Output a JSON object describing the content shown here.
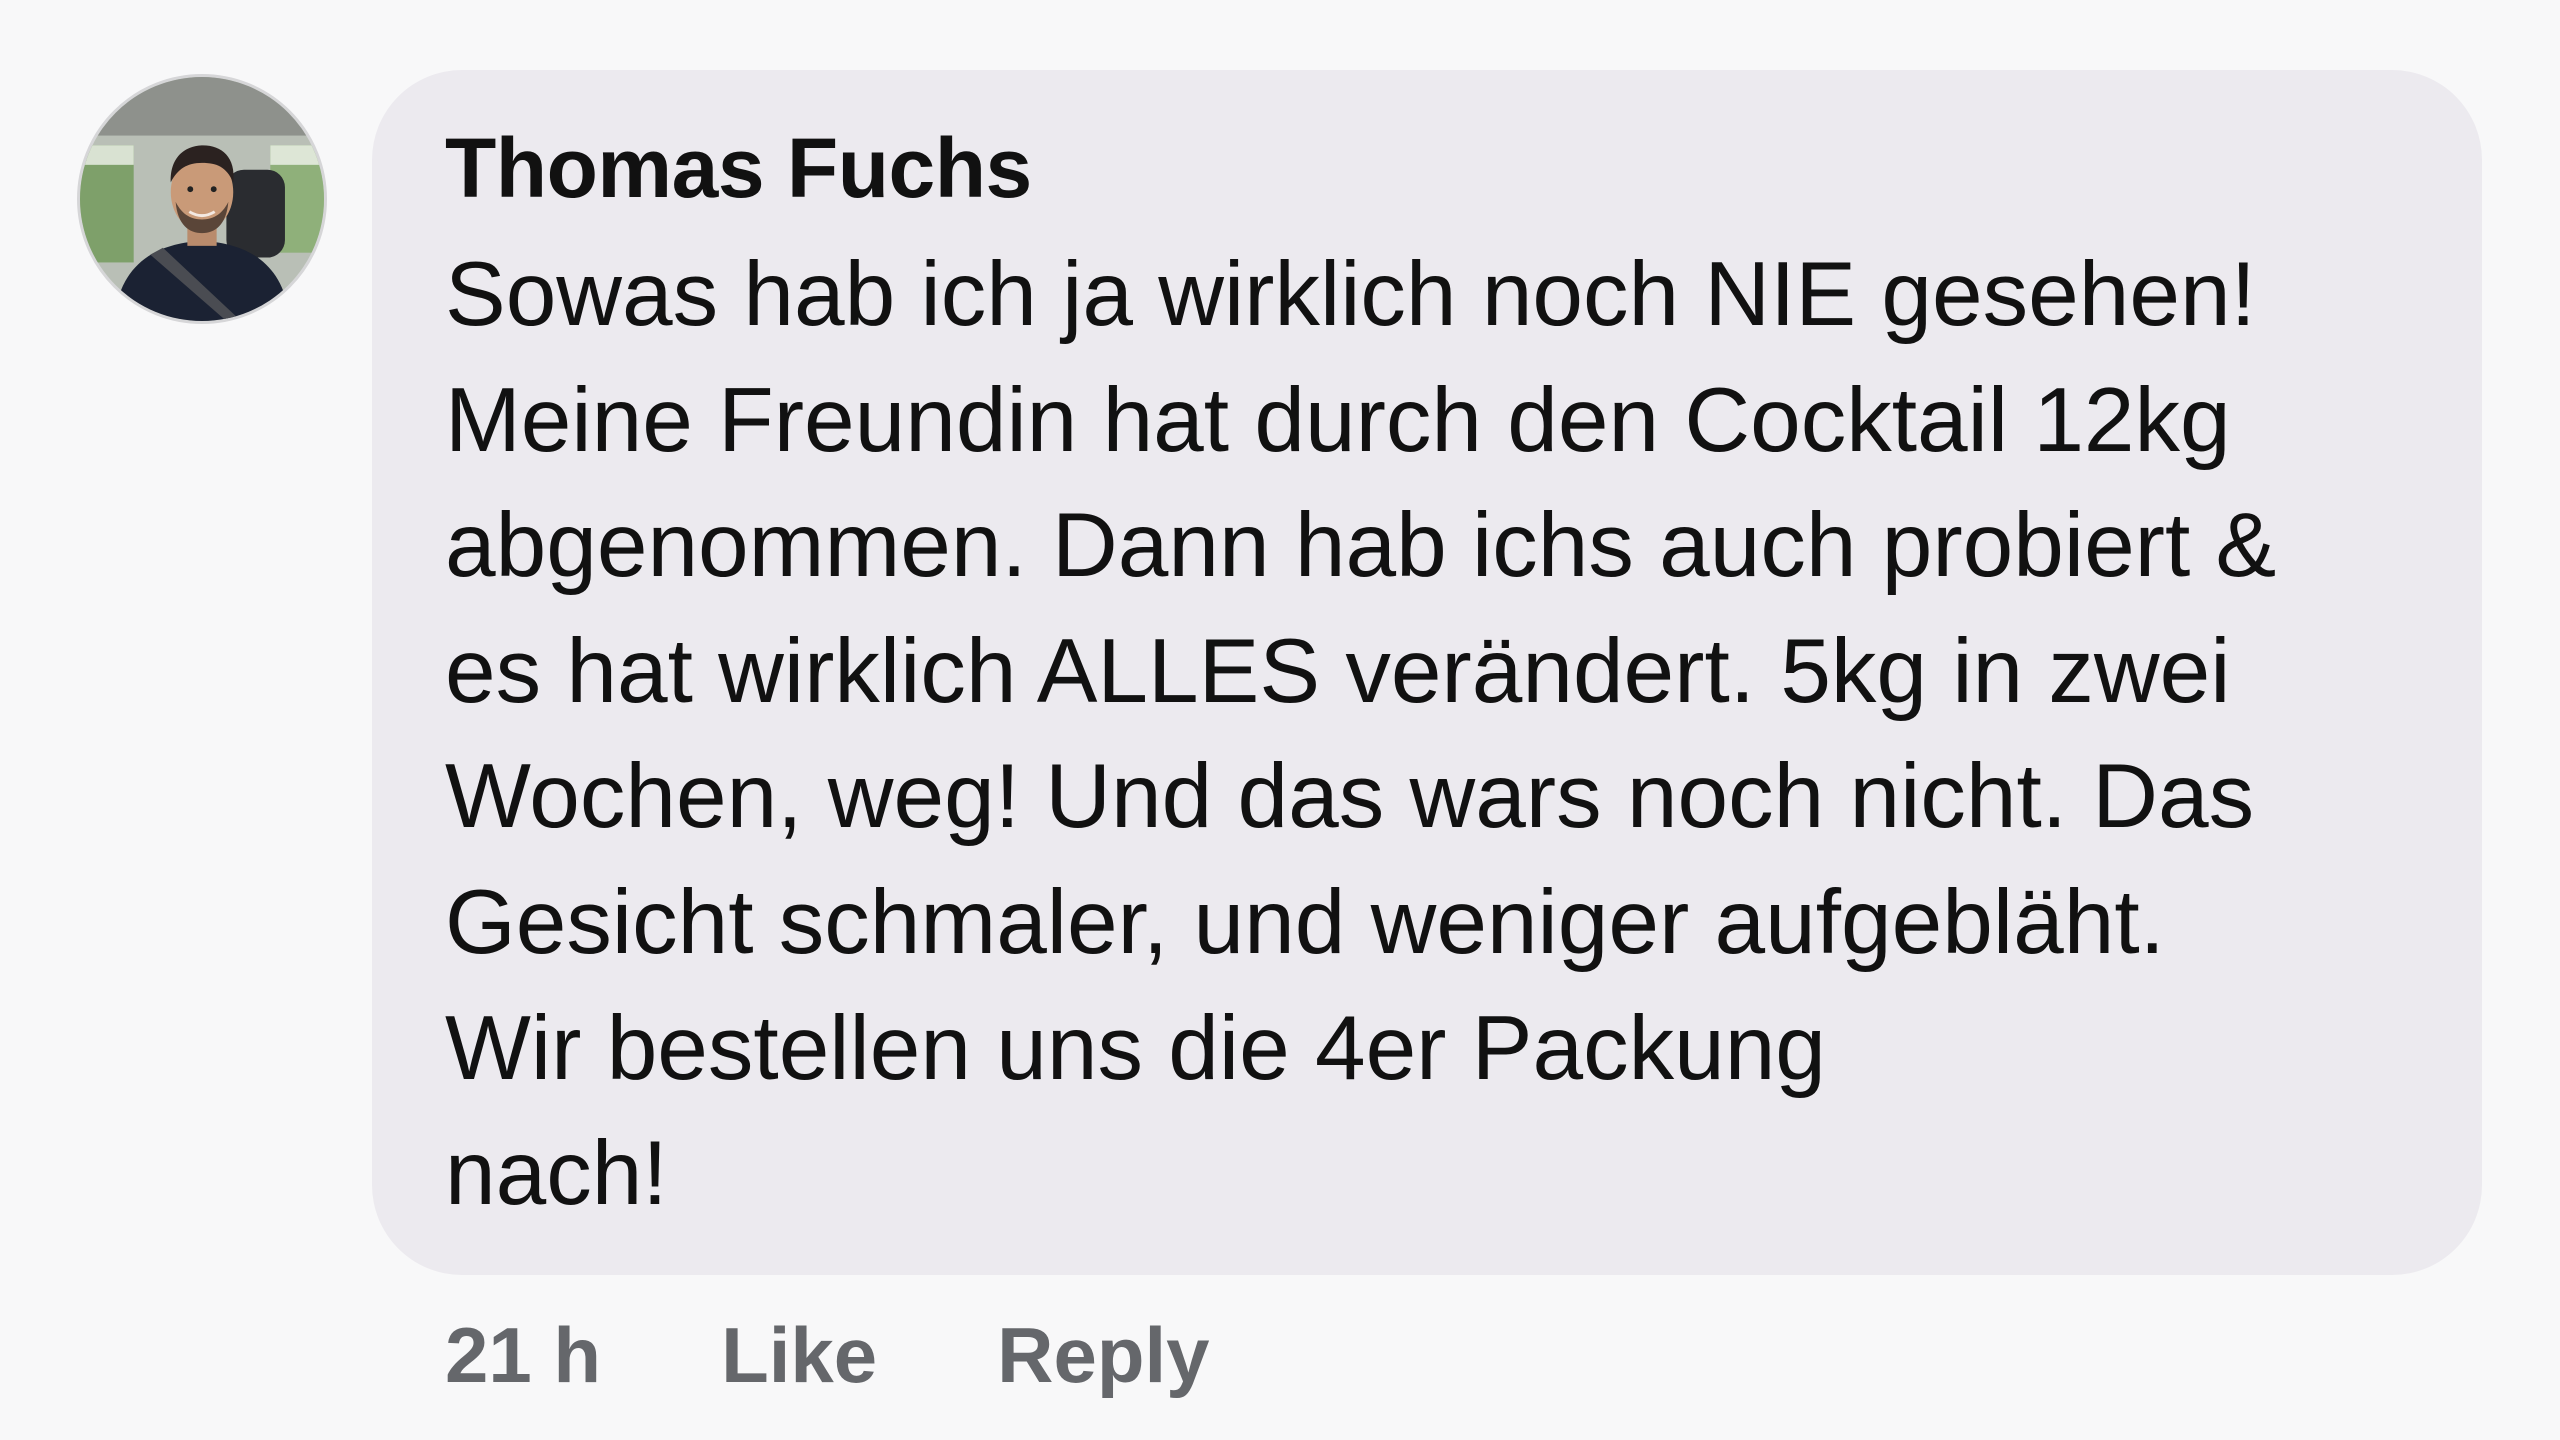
{
  "comment": {
    "author": "Thomas Fuchs",
    "avatar_icon": "profile-photo",
    "lines": [
      "Sowas hab ich ja wirklich noch NIE gesehen!",
      "Meine Freundin hat durch den Cocktail 12kg",
      "abgenommen. Dann hab ichs auch probiert &",
      "es hat wirklich ALLES verändert. 5kg in zwei",
      "Wochen, weg! Und das wars noch nicht. Das",
      "Gesicht schmaler, und weniger aufgebläht.",
      "Wir bestellen uns die 4er Packung",
      "nach!"
    ],
    "meta": {
      "timestamp": "21 h",
      "like_label": "Like",
      "reply_label": "Reply"
    }
  },
  "colors": {
    "background": "#f8f8f9",
    "bubble": "#eceaef",
    "text": "#111111",
    "meta_text": "#65676b"
  }
}
